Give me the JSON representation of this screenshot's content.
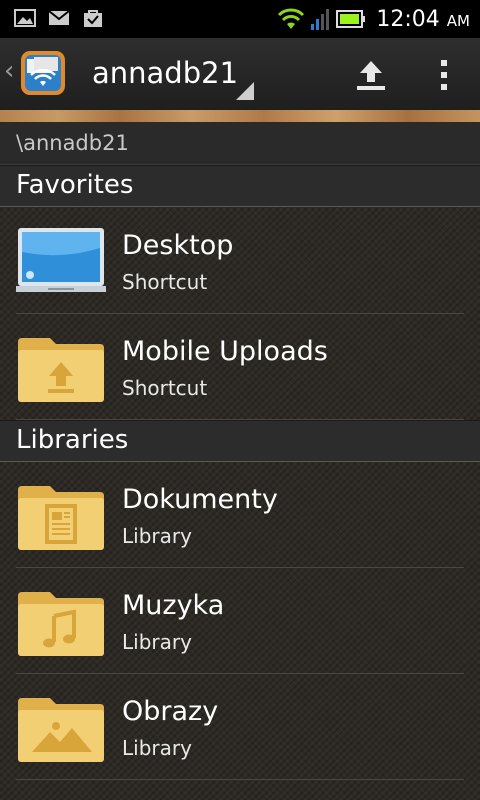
{
  "status_bar": {
    "time": "12:04",
    "ampm": "AM",
    "left_icons": [
      "gallery-icon",
      "gmail-icon",
      "bag-icon"
    ],
    "right_icons": [
      "wifi-icon",
      "signal-icon",
      "battery-icon"
    ],
    "battery_level": 0.8,
    "colors": {
      "wifi": "#8ed61b",
      "signal": "#2f7ad3",
      "battery": "#9bf21c"
    }
  },
  "action_bar": {
    "title": "annadb21",
    "app_icon": "wifi-folder-app-icon",
    "actions": [
      "upload-icon",
      "overflow-menu-icon"
    ]
  },
  "path": "\\annadb21",
  "sections": [
    {
      "label": "Favorites",
      "items": [
        {
          "title": "Desktop",
          "subtitle": "Shortcut",
          "icon": "desktop-monitor-icon"
        },
        {
          "title": "Mobile Uploads",
          "subtitle": "Shortcut",
          "icon": "upload-folder-icon"
        }
      ]
    },
    {
      "label": "Libraries",
      "items": [
        {
          "title": "Dokumenty",
          "subtitle": "Library",
          "icon": "documents-folder-icon"
        },
        {
          "title": "Muzyka",
          "subtitle": "Library",
          "icon": "music-folder-icon"
        },
        {
          "title": "Obrazy",
          "subtitle": "Library",
          "icon": "pictures-folder-icon"
        }
      ]
    }
  ],
  "theme": {
    "folder": "#f2cf73",
    "folder_dark": "#e0b14b",
    "glyph": "#d8a53a",
    "wood": "#b5824e"
  }
}
